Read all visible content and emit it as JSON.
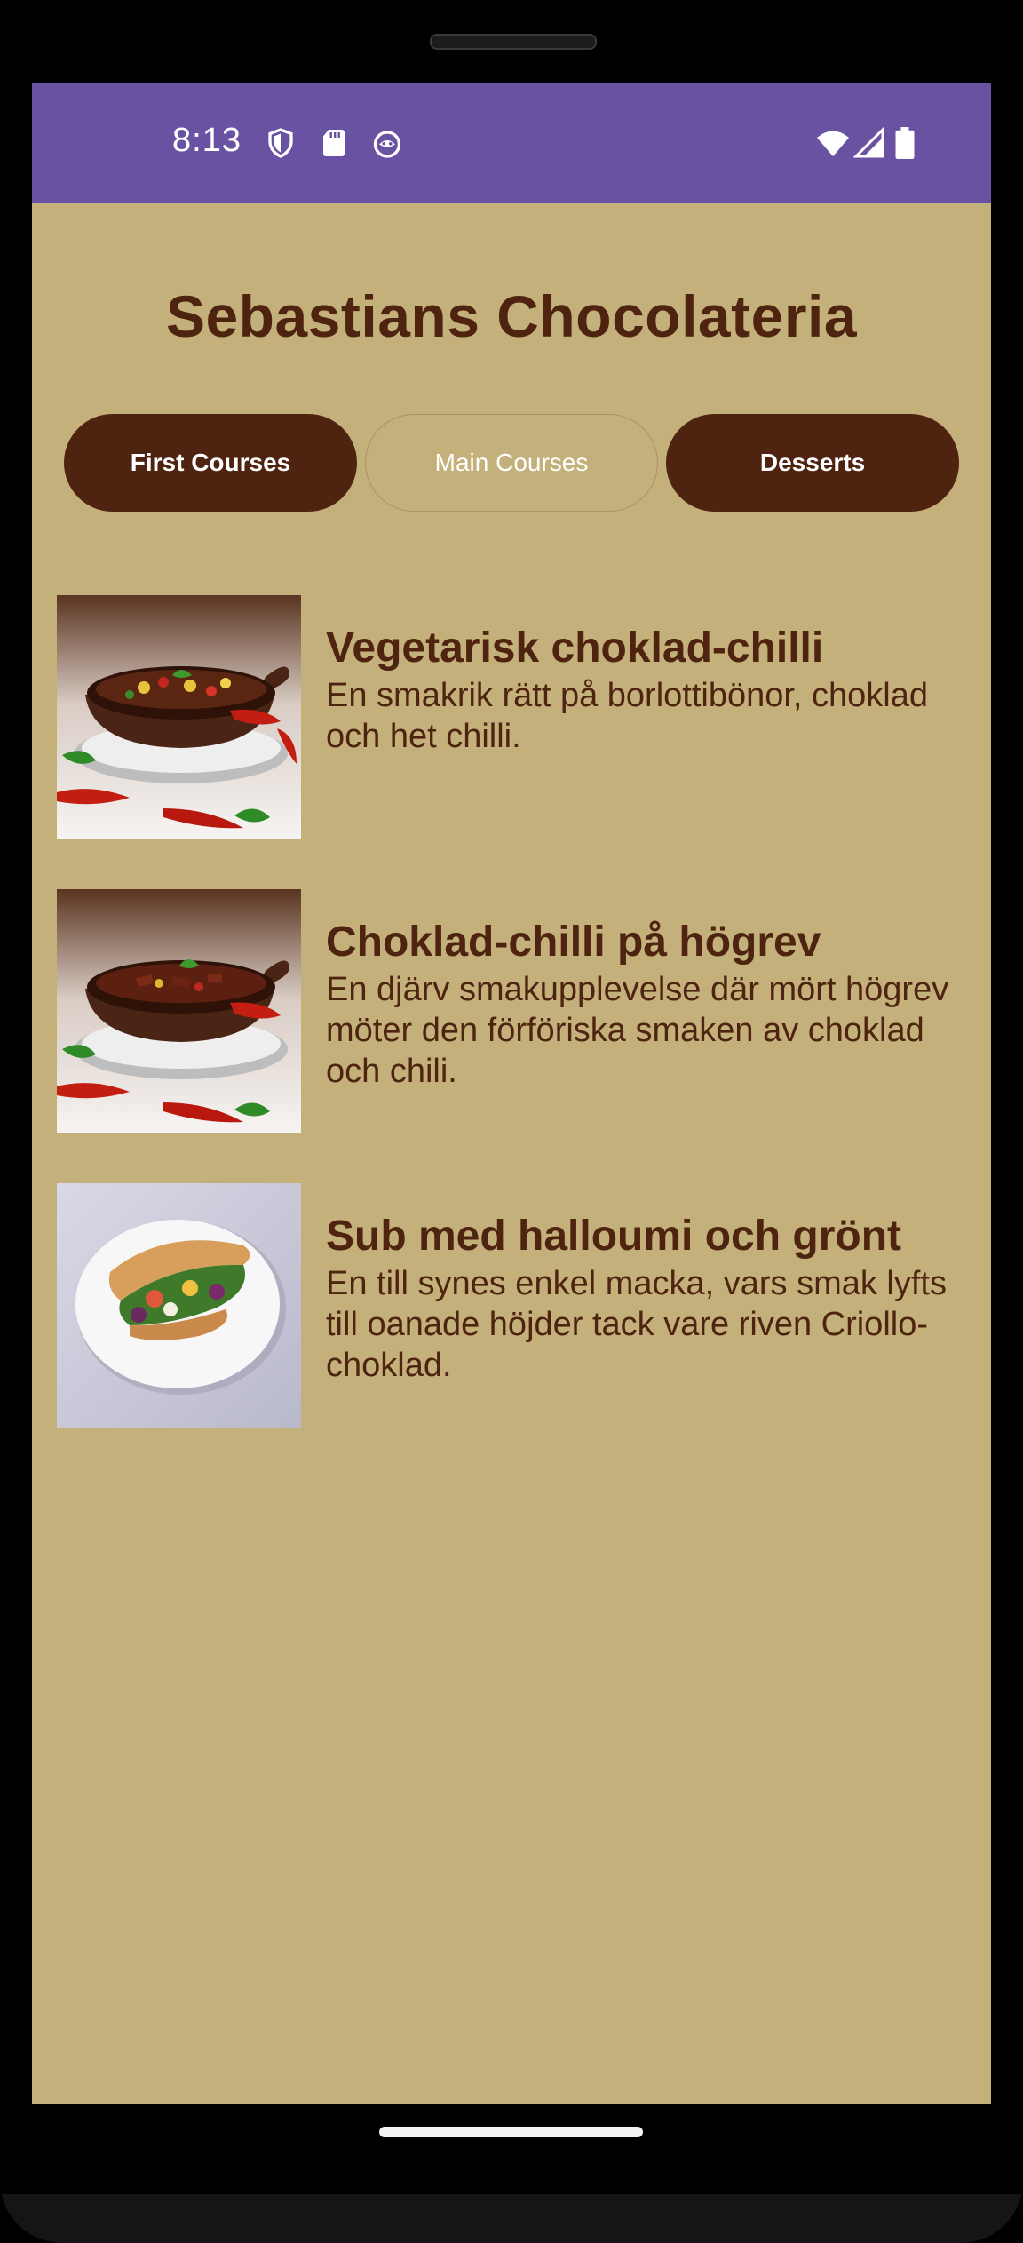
{
  "status_bar": {
    "time": "8:13",
    "left_icons": [
      "shield-icon",
      "sd-card-icon",
      "cat-face-icon"
    ],
    "right_icons": [
      "wifi-icon",
      "signal-icon",
      "battery-icon"
    ],
    "color": "#6a52a3"
  },
  "app": {
    "title": "Sebastians Chocolateria",
    "background": "#c4b07a",
    "accent": "#4e2410"
  },
  "tabs": [
    {
      "label": "First Courses",
      "active": false
    },
    {
      "label": "Main Courses",
      "active": true
    },
    {
      "label": "Desserts",
      "active": false
    }
  ],
  "menu_items": [
    {
      "name": "Vegetarisk choklad-chilli",
      "description": "En smakrik rätt på borlottibönor, choklad och het chilli.",
      "image": "chili-bowl-image"
    },
    {
      "name": "Choklad-chilli på högrev",
      "description": "En djärv smakupplevelse där mört högrev möter den förföriska smaken av choklad och chili.",
      "image": "beef-chili-bowl-image"
    },
    {
      "name": "Sub med halloumi och grönt",
      "description": "En till synes enkel macka, vars smak lyfts till oanade höjder tack vare riven Criollo-choklad.",
      "image": "sub-sandwich-image"
    }
  ]
}
